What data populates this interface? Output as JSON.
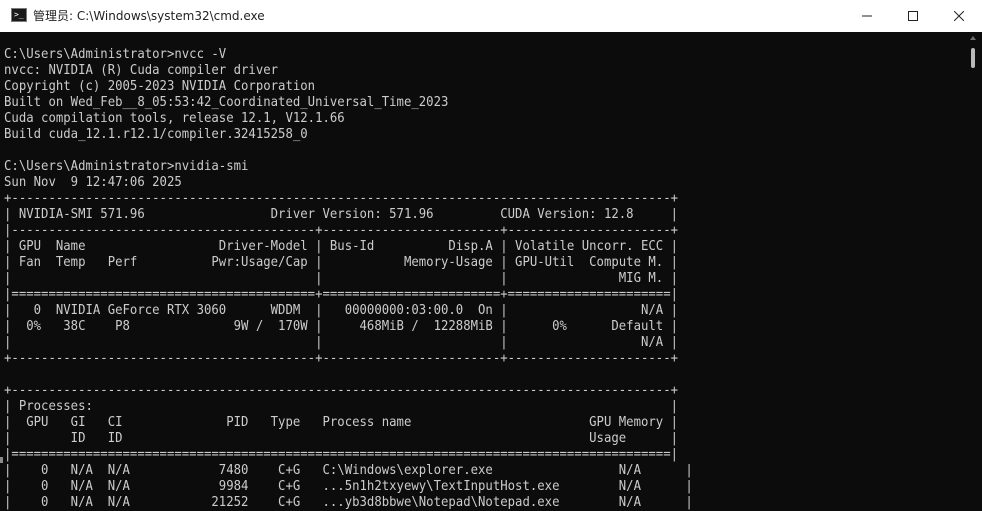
{
  "window": {
    "title": "管理员: C:\\Windows\\system32\\cmd.exe",
    "icon": "cmd-prompt-icon",
    "controls": {
      "minimize": "minimize-icon",
      "maximize": "maximize-icon",
      "close": "close-icon"
    }
  },
  "terminal": {
    "lines": [
      "C:\\Users\\Administrator>nvcc -V",
      "nvcc: NVIDIA (R) Cuda compiler driver",
      "Copyright (c) 2005-2023 NVIDIA Corporation",
      "Built on Wed_Feb__8_05:53:42_Coordinated_Universal_Time_2023",
      "Cuda compilation tools, release 12.1, V12.1.66",
      "Build cuda_12.1.r12.1/compiler.32415258_0",
      "",
      "C:\\Users\\Administrator>nvidia-smi",
      "Sun Nov  9 12:47:06 2025",
      "+-----------------------------------------------------------------------------------------+",
      "| NVIDIA-SMI 571.96                 Driver Version: 571.96         CUDA Version: 12.8     |",
      "|-----------------------------------------+------------------------+----------------------+",
      "| GPU  Name                  Driver-Model | Bus-Id          Disp.A | Volatile Uncorr. ECC |",
      "| Fan  Temp   Perf          Pwr:Usage/Cap |           Memory-Usage | GPU-Util  Compute M. |",
      "|                                         |                        |               MIG M. |",
      "|=========================================+========================+======================|",
      "|   0  NVIDIA GeForce RTX 3060      WDDM  |   00000000:03:00.0  On |                  N/A |",
      "|  0%   38C    P8              9W /  170W |     468MiB /  12288MiB |      0%      Default |",
      "|                                         |                        |                  N/A |",
      "+-----------------------------------------+------------------------+----------------------+",
      "",
      "+-----------------------------------------------------------------------------------------+",
      "| Processes:                                                                              |",
      "|  GPU   GI   CI              PID   Type   Process name                        GPU Memory |",
      "|        ID   ID                                                               Usage      |",
      "|=========================================================================================|",
      "|    0   N/A  N/A            7480    C+G   C:\\Windows\\explorer.exe                 N/A      |",
      "|    0   N/A  N/A            9984    C+G   ...5n1h2txyewy\\TextInputHost.exe        N/A      |",
      "|    0   N/A  N/A           21252    C+G   ...yb3d8bbwe\\Notepad\\Notepad.exe        N/A      |"
    ]
  },
  "colors": {
    "terminal_bg": "#0c0c0c",
    "terminal_fg": "#cccccc",
    "titlebar_bg": "#ffffff"
  }
}
